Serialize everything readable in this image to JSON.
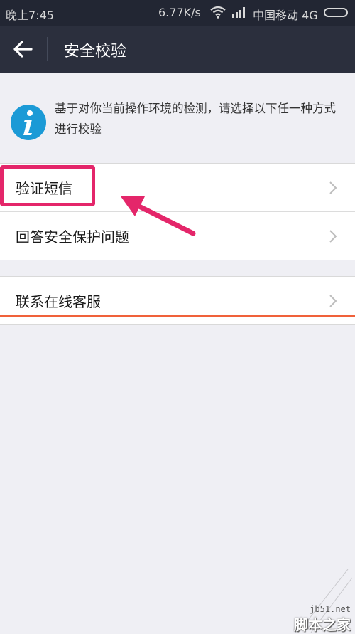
{
  "status_bar": {
    "time": "晚上7:45",
    "speed": "6.77K/s",
    "carrier": "中国移动 4G"
  },
  "header": {
    "title": "安全校验"
  },
  "info": {
    "text": "基于对你当前操作环境的检测，请选择以下任一种方式进行校验",
    "icon": "info-icon"
  },
  "options": [
    {
      "label": "验证短信"
    },
    {
      "label": "回答安全保护问题"
    },
    {
      "label": "联系在线客服"
    }
  ],
  "colors": {
    "status_bar": "#222633",
    "app_bar": "#2b2f3d",
    "background": "#efeff4",
    "info_icon": "#1b9ad6",
    "highlight": "#e4266a",
    "accent_line": "#f0613a"
  },
  "watermark": {
    "site": "jb51.net",
    "name": "脚本之家"
  }
}
